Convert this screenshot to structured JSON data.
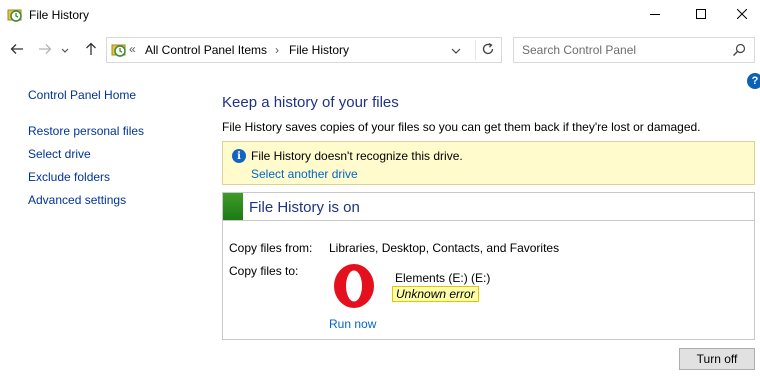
{
  "window": {
    "title": "File History",
    "app_icon": "file-history-icon"
  },
  "titlebar_controls": {
    "minimize_icon": "minimize-icon",
    "maximize_icon": "maximize-icon",
    "close_icon": "close-icon"
  },
  "address": {
    "overflow": "«",
    "crumbs": [
      "All Control Panel Items",
      "File History"
    ],
    "separator": "›"
  },
  "search": {
    "placeholder": "Search Control Panel"
  },
  "help": {
    "glyph": "?"
  },
  "sidebar": {
    "home": "Control Panel Home",
    "items": [
      "Restore personal files",
      "Select drive",
      "Exclude folders",
      "Advanced settings"
    ]
  },
  "main": {
    "title": "Keep a history of your files",
    "description": "File History saves copies of your files so you can get them back if they're lost or damaged."
  },
  "info": {
    "glyph": "i",
    "message": "File History doesn't recognize this drive.",
    "link": "Select another drive"
  },
  "status": {
    "title": "File History is on",
    "copy_from_label": "Copy files from:",
    "copy_from_value": "Libraries, Desktop, Contacts, and Favorites",
    "copy_to_label": "Copy files to:",
    "drive_name": "Elements (E:) (E:)",
    "drive_error": "Unknown error",
    "run_now": "Run now",
    "status_color": "#2e8b1f"
  },
  "actions": {
    "turn_off": "Turn off"
  },
  "colors": {
    "link": "#0066cc",
    "heading": "#1e3287",
    "info_bg": "#fffbcc"
  }
}
